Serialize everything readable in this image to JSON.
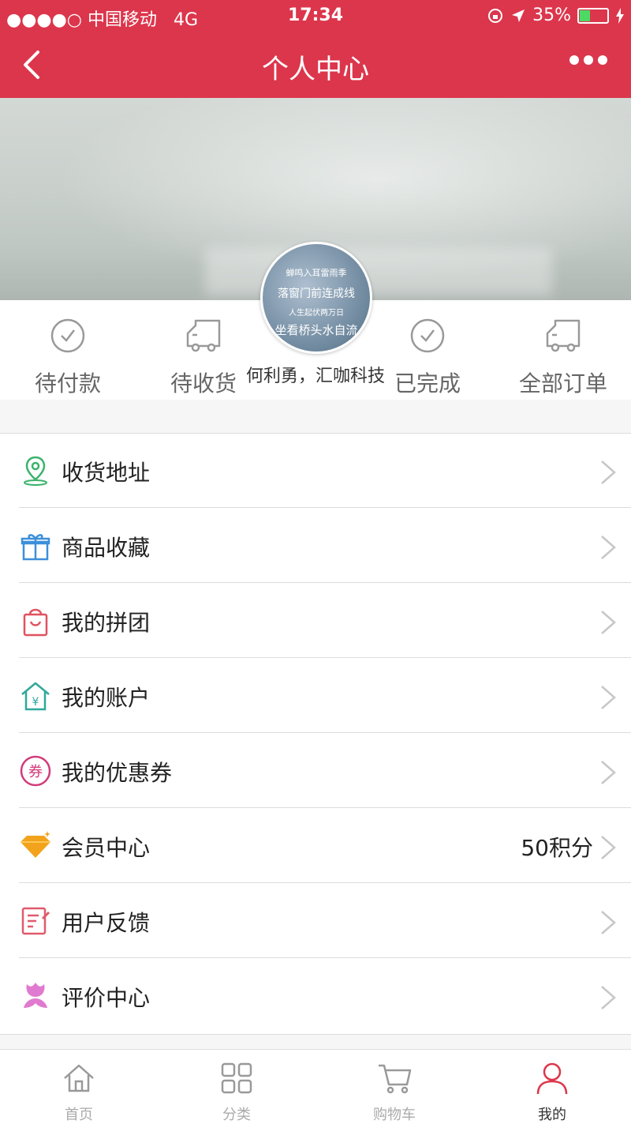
{
  "status_bar": {
    "carrier": "●●●●○ 中国移动",
    "network": "4G",
    "time": "17:34",
    "battery": "35%",
    "battery_level": 0.35
  },
  "nav": {
    "title": "个人中心"
  },
  "profile": {
    "avatar_lines": [
      "蝉鸣入耳雷雨季",
      "落窗门前连成线",
      "人生起伏两万日",
      "坐看桥头水自流"
    ],
    "name": "何利勇，汇咖科技"
  },
  "orders": [
    {
      "label": "待付款",
      "icon": "check-circle-icon"
    },
    {
      "label": "待收货",
      "icon": "truck-icon"
    },
    {
      "label": "已完成",
      "icon": "check-circle-icon"
    },
    {
      "label": "全部订单",
      "icon": "truck-icon"
    }
  ],
  "menu": [
    {
      "label": "收货地址",
      "icon": "location-pin-icon",
      "color": "#3bb36b",
      "value": ""
    },
    {
      "label": "商品收藏",
      "icon": "gift-icon",
      "color": "#3d8fd9",
      "value": ""
    },
    {
      "label": "我的拼团",
      "icon": "shopping-bag-icon",
      "color": "#e0525f",
      "value": ""
    },
    {
      "label": "我的账户",
      "icon": "house-yen-icon",
      "color": "#2fa89b",
      "value": ""
    },
    {
      "label": "我的优惠券",
      "icon": "coupon-icon",
      "color": "#d13c7a",
      "value": ""
    },
    {
      "label": "会员中心",
      "icon": "diamond-icon",
      "color": "#f2a31b",
      "value": "50积分"
    },
    {
      "label": "用户反馈",
      "icon": "feedback-icon",
      "color": "#e05b6b",
      "value": ""
    },
    {
      "label": "评价中心",
      "icon": "flower-icon",
      "color": "#e07ad0",
      "value": ""
    }
  ],
  "tabs": [
    {
      "label": "首页",
      "icon": "home-icon"
    },
    {
      "label": "分类",
      "icon": "grid-icon"
    },
    {
      "label": "购物车",
      "icon": "cart-icon"
    },
    {
      "label": "我的",
      "icon": "user-icon",
      "active": true
    }
  ],
  "colors": {
    "brand": "#dc364c",
    "active_tab": "#dc364c"
  }
}
